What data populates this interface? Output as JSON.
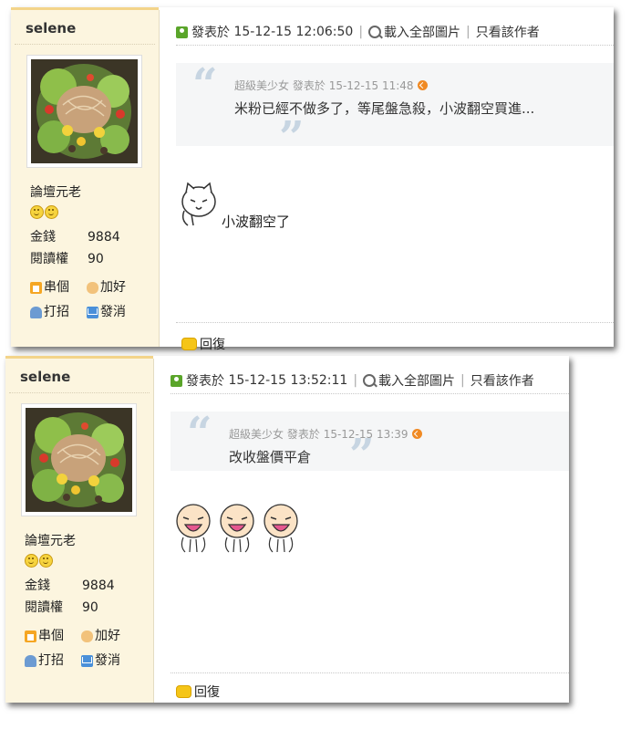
{
  "posts": [
    {
      "author": "selene",
      "rank": "論壇元老",
      "stats": [
        {
          "label": "金錢",
          "value": "9884"
        },
        {
          "label": "閱讀權",
          "value": "90"
        }
      ],
      "actions": [
        {
          "label": "串個",
          "icon": "home-icon"
        },
        {
          "label": "加好",
          "icon": "handshake-icon"
        },
        {
          "label": "打招",
          "icon": "poke-icon"
        },
        {
          "label": "發消",
          "icon": "mail-icon"
        }
      ],
      "meta": {
        "posted_label": "發表於",
        "timestamp": "15-12-15 12:06:50",
        "load_images": "載入全部圖片",
        "author_only": "只看該作者"
      },
      "quote": {
        "author": "超級美少女",
        "posted_label": "發表於",
        "timestamp": "15-12-15 11:48",
        "text": "米粉已經不做多了，等尾盤急殺，小波翻空買進..."
      },
      "body": "小波翻空了",
      "reply_label": "回復"
    },
    {
      "author": "selene",
      "rank": "論壇元老",
      "stats": [
        {
          "label": "金錢",
          "value": "9884"
        },
        {
          "label": "閱讀權",
          "value": "90"
        }
      ],
      "actions": [
        {
          "label": "串個",
          "icon": "home-icon"
        },
        {
          "label": "加好",
          "icon": "handshake-icon"
        },
        {
          "label": "打招",
          "icon": "poke-icon"
        },
        {
          "label": "發消",
          "icon": "mail-icon"
        }
      ],
      "meta": {
        "posted_label": "發表於",
        "timestamp": "15-12-15 13:52:11",
        "load_images": "載入全部圖片",
        "author_only": "只看該作者"
      },
      "quote": {
        "author": "超級美少女",
        "posted_label": "發表於",
        "timestamp": "15-12-15 13:39",
        "text": "改收盤價平倉"
      },
      "body": "",
      "reply_label": "回復"
    }
  ]
}
